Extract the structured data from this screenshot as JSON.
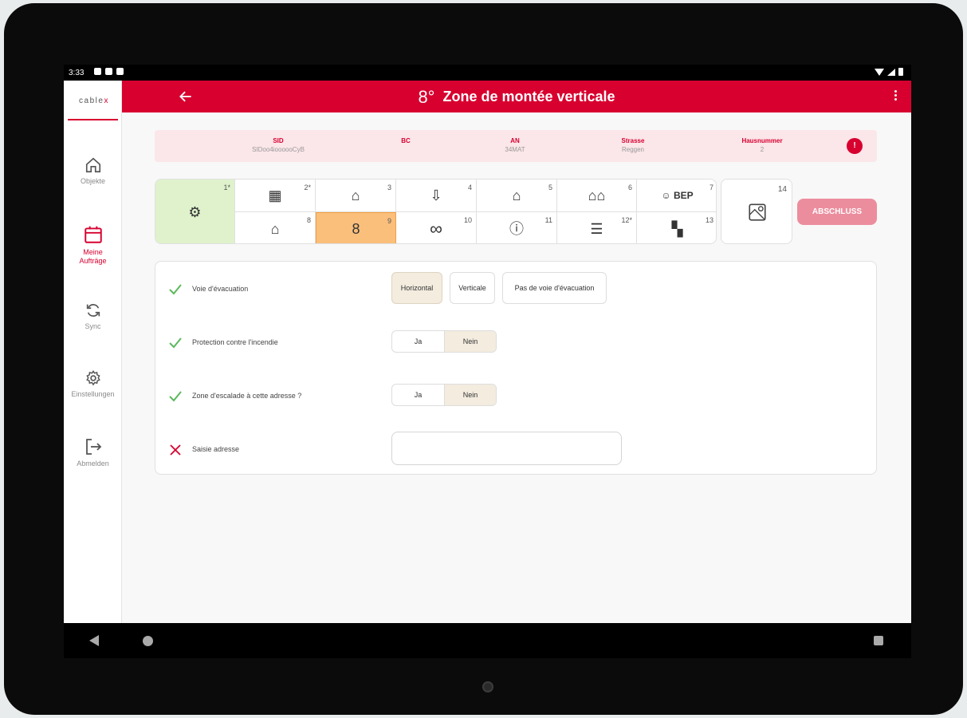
{
  "status_bar": {
    "time": "3:33"
  },
  "brand": {
    "logo_text_a": "cable",
    "logo_text_b": "x"
  },
  "sidebar": {
    "items": [
      {
        "label": "Objekte",
        "icon": "home-icon",
        "active": false
      },
      {
        "label": "Meine Aufträge",
        "icon": "calendar-icon",
        "active": true
      },
      {
        "label": "Sync",
        "icon": "sync-icon",
        "active": false
      },
      {
        "label": "Einstellungen",
        "icon": "gear-icon",
        "active": false
      },
      {
        "label": "Abmelden",
        "icon": "logout-icon",
        "active": false
      }
    ]
  },
  "header": {
    "icon_glyph": "8°",
    "title": "Zone de montée verticale"
  },
  "info": {
    "columns": [
      {
        "key": "SID",
        "value": "SIDoo4ioooooCyB"
      },
      {
        "key": "BC",
        "value": ""
      },
      {
        "key": "AN",
        "value": "34MAT"
      },
      {
        "key": "Strasse",
        "value": "Reggen"
      },
      {
        "key": "Hausnummer",
        "value": "2"
      }
    ],
    "badge": "!"
  },
  "steps": {
    "cells": [
      {
        "num": "1*",
        "icon": "network-icon",
        "glyph": "⚙",
        "state": "done"
      },
      {
        "num": "2*",
        "icon": "building-icon",
        "glyph": "▦",
        "state": ""
      },
      {
        "num": "3",
        "icon": "house-plug-icon",
        "glyph": "⌂",
        "state": ""
      },
      {
        "num": "4",
        "icon": "location-arrow-icon",
        "glyph": "⇩",
        "state": ""
      },
      {
        "num": "5",
        "icon": "house-bep-icon",
        "glyph": "⌂",
        "state": ""
      },
      {
        "num": "6",
        "icon": "houses-icon",
        "glyph": "⌂⌂",
        "state": ""
      },
      {
        "num": "7",
        "icon": "person-bep-icon",
        "glyph": "☺ BEP",
        "state": ""
      },
      {
        "num": "8",
        "icon": "house-bep-2-icon",
        "glyph": "⌂",
        "state": ""
      },
      {
        "num": "9",
        "icon": "vertical-cable-icon",
        "glyph": "8",
        "state": "current"
      },
      {
        "num": "10",
        "icon": "horizontal-cable-icon",
        "glyph": "∞",
        "state": ""
      },
      {
        "num": "11",
        "icon": "house-info-icon",
        "glyph": "ⓘ",
        "state": ""
      },
      {
        "num": "12*",
        "icon": "checklist-icon",
        "glyph": "☰",
        "state": ""
      },
      {
        "num": "13",
        "icon": "finish-flag-icon",
        "glyph": "▚",
        "state": ""
      }
    ],
    "cell14": {
      "num": "14",
      "icon": "map-icon"
    },
    "finish_label": "ABSCHLUSS"
  },
  "form": {
    "rows": [
      {
        "label": "Voie d'évacuation",
        "status": "check-icon"
      },
      {
        "label": "Protection contre l'incendie",
        "status": "check-icon"
      },
      {
        "label": "Zone d'escalade à cette adresse ?",
        "status": "check-icon"
      },
      {
        "label": "Saisie adresse",
        "status": "cross-icon"
      }
    ],
    "evac_options": [
      "Horizontal",
      "Verticale",
      "Pas de voie d'évacuation"
    ],
    "evac_selected": "Horizontal",
    "fire": {
      "yes": "Ja",
      "no": "Nein",
      "selected": "Nein"
    },
    "climb": {
      "yes": "Ja",
      "no": "Nein",
      "selected": "Nein"
    },
    "address_value": ""
  },
  "colors": {
    "brand": "#d7002f",
    "done": "#dff2cc",
    "current": "#fbbf7c",
    "selected_option": "#f3ecdf"
  }
}
